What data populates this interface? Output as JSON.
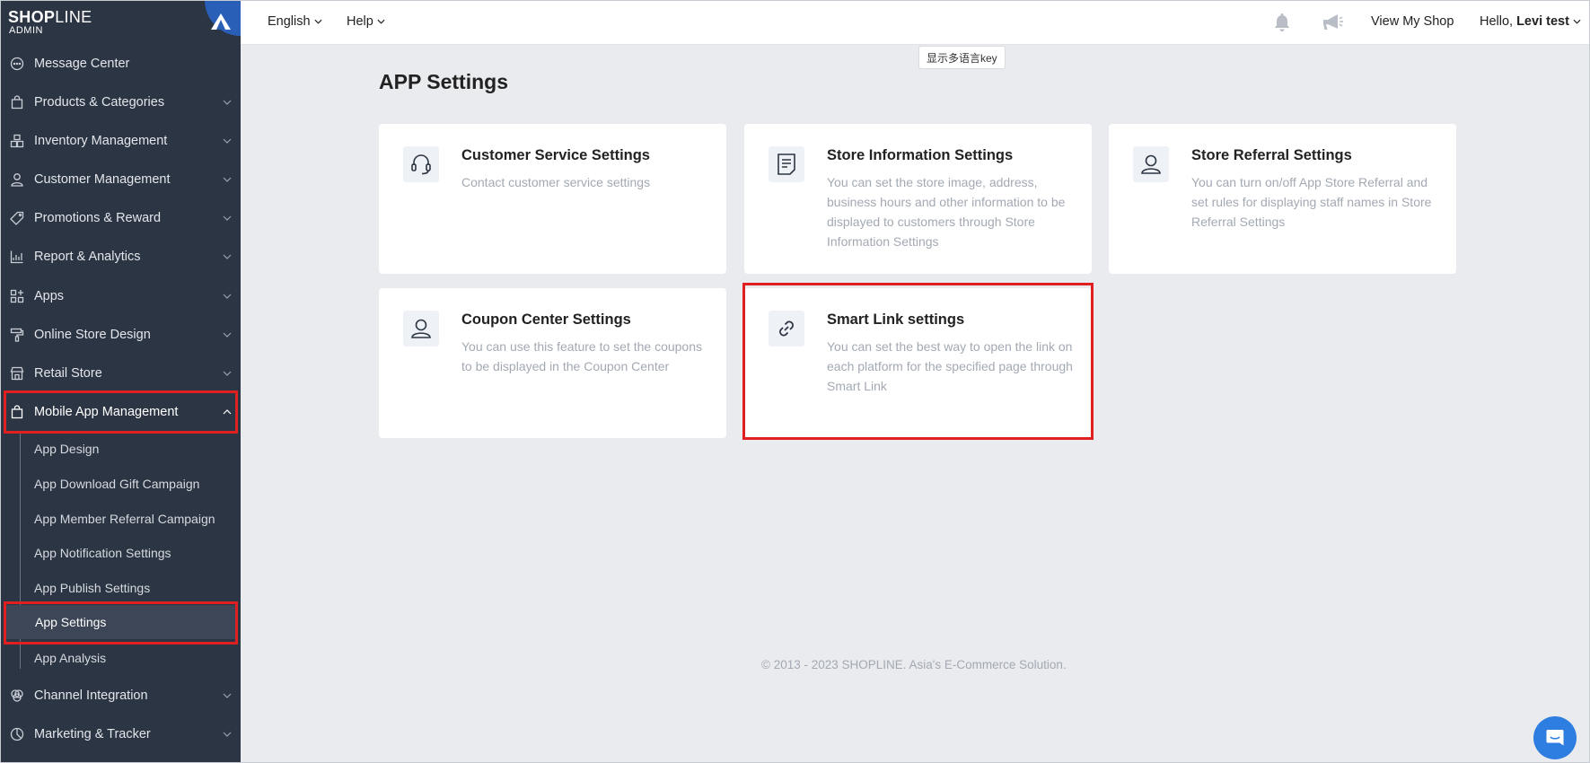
{
  "logo": {
    "brand_bold": "SHOP",
    "brand_light": "LINE",
    "admin": "ADMIN"
  },
  "sidebar": {
    "items": [
      {
        "label": "Message Center",
        "icon": "chat-bubble-icon",
        "has_chevron": false
      },
      {
        "label": "Products & Categories",
        "icon": "bag-icon",
        "has_chevron": true
      },
      {
        "label": "Inventory Management",
        "icon": "boxes-icon",
        "has_chevron": true
      },
      {
        "label": "Customer Management",
        "icon": "user-icon",
        "has_chevron": true
      },
      {
        "label": "Promotions & Reward",
        "icon": "tag-icon",
        "has_chevron": true
      },
      {
        "label": "Report & Analytics",
        "icon": "chart-icon",
        "has_chevron": true
      },
      {
        "label": "Apps",
        "icon": "apps-grid-icon",
        "has_chevron": true
      },
      {
        "label": "Online Store Design",
        "icon": "paint-roller-icon",
        "has_chevron": true
      },
      {
        "label": "Retail Store",
        "icon": "store-icon",
        "has_chevron": true
      },
      {
        "label": "Mobile App Management",
        "icon": "bag-icon",
        "has_chevron": true,
        "expanded": true
      }
    ],
    "sub_items": [
      "App Design",
      "App Download Gift Campaign",
      "App Member Referral Campaign",
      "App Notification Settings",
      "App Publish Settings",
      "App Settings",
      "App Analysis"
    ],
    "selected_sub": "App Settings",
    "bottom_items": [
      {
        "label": "Channel Integration",
        "icon": "channels-icon"
      },
      {
        "label": "Marketing & Tracker",
        "icon": "marketing-icon"
      }
    ]
  },
  "topbar": {
    "language": "English",
    "help": "Help",
    "view_shop": "View My Shop",
    "greeting": "Hello,",
    "user_name": "Levi test"
  },
  "tooltip": "显示多语言key",
  "main": {
    "title": "APP Settings",
    "cards": [
      {
        "title": "Customer Service Settings",
        "desc": "Contact customer service settings",
        "icon": "headset-icon"
      },
      {
        "title": "Store Information Settings",
        "desc": "You can set the store image, address, business hours and other information to be displayed to customers through Store Information Settings",
        "icon": "document-icon"
      },
      {
        "title": "Store Referral Settings",
        "desc": "You can turn on/off App Store Referral and set rules for displaying staff names in Store Referral Settings",
        "icon": "user-icon"
      },
      {
        "title": "Coupon Center Settings",
        "desc": "You can use this feature to set the coupons to be displayed in the Coupon Center",
        "icon": "user-icon"
      },
      {
        "title": "Smart Link settings",
        "desc": "You can set the best way to open the link on each platform for the specified page through Smart Link",
        "icon": "link-icon"
      }
    ]
  },
  "footer": "© 2013 - 2023  SHOPLINE. Asia's E-Commerce Solution.",
  "colors": {
    "sidebar_bg": "#2c3543",
    "accent": "#2e7de1",
    "highlight": "#e02020"
  }
}
